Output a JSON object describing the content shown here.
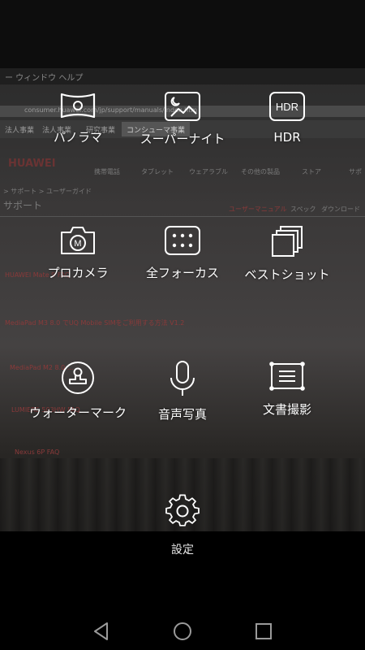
{
  "viewfinder": {
    "browser_title": "ー ウィンドウ ヘルプ",
    "url": "consumer.huawei.com/jp/support/manuals/index.htm",
    "tabs": [
      "法人事業",
      "法人事業",
      "研究事業",
      "コンシューマ事業"
    ],
    "brand": "HUAWEI",
    "nav_items": [
      "携帯電話",
      "タブレット",
      "ウェアラブル",
      "その他の製品",
      "ストア",
      "サポ"
    ],
    "breadcrumb": "> サポート > ユーザーガイド",
    "support_heading": "サポート",
    "links": [
      "ユーザーマニュアル",
      "スペック",
      "ダウンロード"
    ],
    "faq_items": [
      "HUAWEI Mate 9 FAQ",
      "MediaPad M3 8.0 でUQ Mobile SIMをご利用する方法 V1.2",
      "MediaPad M2 8.0 ...",
      "LUMIERE 503HW FAQ",
      "Nexus 6P FAQ"
    ]
  },
  "modes": [
    {
      "name": "mode-panorama",
      "icon": "panorama-icon",
      "label": "パノラマ"
    },
    {
      "name": "mode-super-night",
      "icon": "night-moon-icon",
      "label": "スーパーナイト"
    },
    {
      "name": "mode-hdr",
      "icon": "hdr-icon",
      "icon_text": "HDR",
      "label": "HDR"
    },
    {
      "name": "mode-pro-camera",
      "icon": "pro-camera-icon",
      "icon_text": "M",
      "label": "プロカメラ"
    },
    {
      "name": "mode-all-focus",
      "icon": "all-focus-icon",
      "label": "全フォーカス"
    },
    {
      "name": "mode-best-shot",
      "icon": "best-shot-icon",
      "label": "ベストショット"
    },
    {
      "name": "mode-watermark",
      "icon": "watermark-stamp-icon",
      "label": "ウォーターマーク"
    },
    {
      "name": "mode-audio-note",
      "icon": "microphone-icon",
      "label": "音声写真"
    },
    {
      "name": "mode-document-scan",
      "icon": "document-scan-icon",
      "label": "文書撮影"
    }
  ],
  "settings": {
    "icon": "gear-icon",
    "label": "設定"
  },
  "navigation": {
    "back": "back-icon",
    "home": "home-icon",
    "recents": "recents-icon"
  },
  "colors": {
    "icon_stroke": "#ffffff",
    "panel_bg": "#000000"
  }
}
